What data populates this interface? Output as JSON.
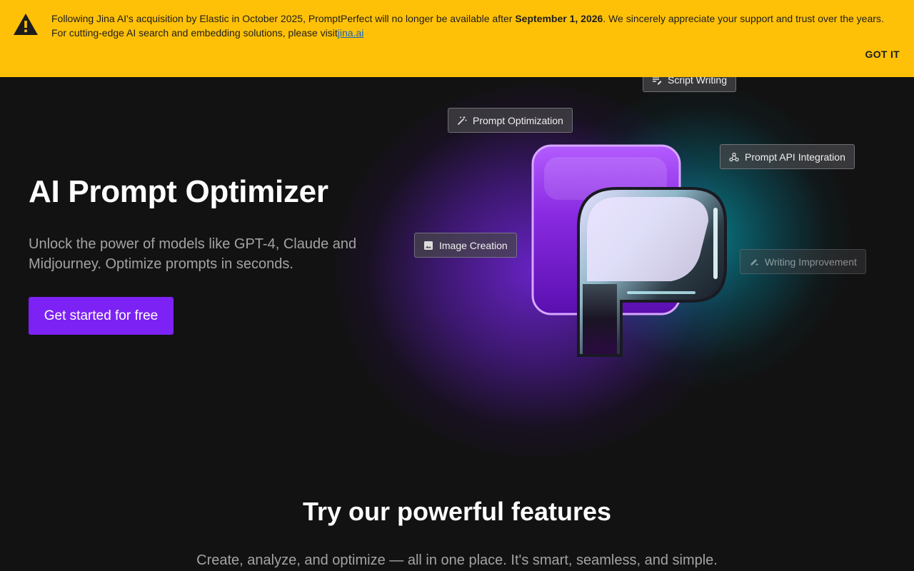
{
  "banner": {
    "message_part1": "Following Jina AI's acquisition by Elastic in October 2025, PromptPerfect will no longer be available after ",
    "message_date": "September 1, 2026",
    "message_part2": ". We sincerely appreciate your support and trust over the years. For cutting-edge AI search and embedding solutions, please visit",
    "link_text": "jina.ai",
    "dismiss_label": "GOT IT",
    "icon": "warning-icon",
    "background_color": "#ffc107"
  },
  "hero": {
    "title": "AI Prompt Optimizer",
    "subtitle": "Unlock the power of models like GPT-4, Claude and Midjourney. Optimize prompts in seconds.",
    "cta_label": "Get started for free",
    "accent_color": "#7c22f5"
  },
  "chips": [
    {
      "label": "Script Writing",
      "icon": "script-icon"
    },
    {
      "label": "Prompt Optimization",
      "icon": "magic-wand-icon"
    },
    {
      "label": "Prompt API Integration",
      "icon": "webhook-icon"
    },
    {
      "label": "Image Creation",
      "icon": "image-icon"
    },
    {
      "label": "Writing Improvement",
      "icon": "edit-sparkle-icon"
    }
  ],
  "features": {
    "title": "Try our powerful features",
    "subtitle": "Create, analyze, and optimize — all in one place. It's smart, seamless, and simple."
  }
}
